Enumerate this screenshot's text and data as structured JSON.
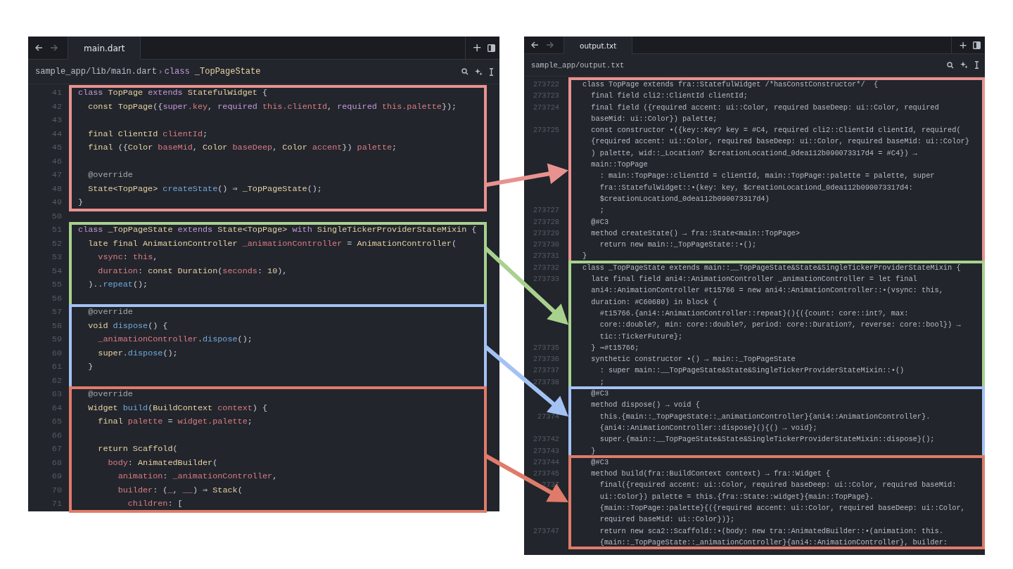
{
  "editors": [
    {
      "tab": {
        "label": "main.dart",
        "selected": true
      },
      "new_tab": "+",
      "breadcrumb": {
        "path": "sample_app/lib/main.dart",
        "separator": "›",
        "symbol": [
          {
            "text": "class ",
            "kind": "keyword"
          },
          {
            "text": "_TopPageState",
            "kind": "type"
          }
        ]
      },
      "sections": [
        {
          "color": "#e8928f",
          "lines": [
            {
              "n": "41",
              "tokens": [
                {
                  "text": "class ",
                  "kind": "keyword"
                },
                {
                  "text": "TopPage ",
                  "kind": "type"
                },
                {
                  "text": "extends ",
                  "kind": "keyword"
                },
                {
                  "text": "StatefulWidget ",
                  "kind": "type"
                },
                {
                  "text": "{",
                  "kind": "plain"
                }
              ]
            },
            {
              "n": "42",
              "tokens": [
                {
                  "text": "  const TopPage",
                  "kind": "type"
                },
                {
                  "text": "({",
                  "kind": "plain"
                },
                {
                  "text": "super",
                  "kind": "keyword"
                },
                {
                  "text": ".key",
                  "kind": "name"
                },
                {
                  "text": ", ",
                  "kind": "plain"
                },
                {
                  "text": "required ",
                  "kind": "keyword"
                },
                {
                  "text": "this.clientId",
                  "kind": "name"
                },
                {
                  "text": ", ",
                  "kind": "plain"
                },
                {
                  "text": "required ",
                  "kind": "keyword"
                },
                {
                  "text": "this.palette",
                  "kind": "name"
                },
                {
                  "text": "});",
                  "kind": "plain"
                }
              ]
            },
            {
              "n": "43"
            },
            {
              "n": "44",
              "tokens": [
                {
                  "text": "  final ClientId ",
                  "kind": "type"
                },
                {
                  "text": "clientId",
                  "kind": "name"
                },
                {
                  "text": ";",
                  "kind": "plain"
                }
              ]
            },
            {
              "n": "45",
              "tokens": [
                {
                  "text": "  final ",
                  "kind": "type"
                },
                {
                  "text": "({",
                  "kind": "plain"
                },
                {
                  "text": "Color ",
                  "kind": "type"
                },
                {
                  "text": "baseMid",
                  "kind": "name"
                },
                {
                  "text": ", ",
                  "kind": "plain"
                },
                {
                  "text": "Color ",
                  "kind": "type"
                },
                {
                  "text": "baseDeep",
                  "kind": "name"
                },
                {
                  "text": ", ",
                  "kind": "plain"
                },
                {
                  "text": "Color ",
                  "kind": "type"
                },
                {
                  "text": "accent",
                  "kind": "name"
                },
                {
                  "text": "}) ",
                  "kind": "plain"
                },
                {
                  "text": "palette",
                  "kind": "name"
                },
                {
                  "text": ";",
                  "kind": "plain"
                }
              ]
            },
            {
              "n": "46"
            },
            {
              "n": "47",
              "tokens": [
                {
                  "text": "  @override",
                  "kind": "annotation"
                }
              ]
            },
            {
              "n": "48",
              "tokens": [
                {
                  "text": "  State<TopPage> ",
                  "kind": "type"
                },
                {
                  "text": "createState",
                  "kind": "call"
                },
                {
                  "text": "() ⇒ ",
                  "kind": "plain"
                },
                {
                  "text": "_TopPageState",
                  "kind": "type"
                },
                {
                  "text": "();",
                  "kind": "plain"
                }
              ]
            },
            {
              "n": "49",
              "tokens": [
                {
                  "text": "}",
                  "kind": "plain"
                }
              ]
            }
          ]
        },
        {
          "lines": [
            {
              "n": "50"
            }
          ]
        },
        {
          "color": "#a9d18e",
          "lines": [
            {
              "n": "51",
              "tokens": [
                {
                  "text": "class ",
                  "kind": "keyword"
                },
                {
                  "text": "_TopPageState ",
                  "kind": "type"
                },
                {
                  "text": "extends ",
                  "kind": "keyword"
                },
                {
                  "text": "State<TopPage> ",
                  "kind": "type"
                },
                {
                  "text": "with ",
                  "kind": "keyword"
                },
                {
                  "text": "SingleTickerProviderStateMixin ",
                  "kind": "type"
                },
                {
                  "text": "{",
                  "kind": "plain"
                }
              ]
            },
            {
              "n": "52",
              "tokens": [
                {
                  "text": "  late final AnimationController ",
                  "kind": "type"
                },
                {
                  "text": "_animationController",
                  "kind": "name"
                },
                {
                  "text": " = ",
                  "kind": "plain"
                },
                {
                  "text": "AnimationController",
                  "kind": "type"
                },
                {
                  "text": "(",
                  "kind": "plain"
                }
              ]
            },
            {
              "n": "53",
              "tokens": [
                {
                  "text": "    vsync",
                  "kind": "name"
                },
                {
                  "text": ": ",
                  "kind": "plain"
                },
                {
                  "text": "this",
                  "kind": "name"
                },
                {
                  "text": ",",
                  "kind": "plain"
                }
              ]
            },
            {
              "n": "54",
              "tokens": [
                {
                  "text": "    duration",
                  "kind": "name"
                },
                {
                  "text": ": ",
                  "kind": "plain"
                },
                {
                  "text": "const Duration",
                  "kind": "type"
                },
                {
                  "text": "(",
                  "kind": "plain"
                },
                {
                  "text": "seconds",
                  "kind": "name"
                },
                {
                  "text": ": ",
                  "kind": "plain"
                },
                {
                  "text": "10",
                  "kind": "type"
                },
                {
                  "text": "),",
                  "kind": "plain"
                }
              ]
            },
            {
              "n": "55",
              "tokens": [
                {
                  "text": "  )..",
                  "kind": "plain"
                },
                {
                  "text": "repeat",
                  "kind": "call"
                },
                {
                  "text": "();",
                  "kind": "plain"
                }
              ]
            },
            {
              "n": "56"
            }
          ]
        },
        {
          "color": "#a4c2f4",
          "lines": [
            {
              "n": "57",
              "tokens": [
                {
                  "text": "  @override",
                  "kind": "annotation"
                }
              ]
            },
            {
              "n": "58",
              "tokens": [
                {
                  "text": "  void ",
                  "kind": "type"
                },
                {
                  "text": "dispose",
                  "kind": "call"
                },
                {
                  "text": "() {",
                  "kind": "plain"
                }
              ]
            },
            {
              "n": "59",
              "tokens": [
                {
                  "text": "    _animationController",
                  "kind": "name"
                },
                {
                  "text": ".",
                  "kind": "plain"
                },
                {
                  "text": "dispose",
                  "kind": "call"
                },
                {
                  "text": "();",
                  "kind": "plain"
                }
              ]
            },
            {
              "n": "60",
              "tokens": [
                {
                  "text": "    super",
                  "kind": "type"
                },
                {
                  "text": ".",
                  "kind": "plain"
                },
                {
                  "text": "dispose",
                  "kind": "call"
                },
                {
                  "text": "();",
                  "kind": "plain"
                }
              ]
            },
            {
              "n": "61",
              "tokens": [
                {
                  "text": "  }",
                  "kind": "plain"
                }
              ]
            },
            {
              "n": "62"
            }
          ]
        },
        {
          "color": "#e07b6a",
          "lines": [
            {
              "n": "63",
              "tokens": [
                {
                  "text": "  @override",
                  "kind": "annotation"
                }
              ]
            },
            {
              "n": "64",
              "tokens": [
                {
                  "text": "  Widget ",
                  "kind": "type"
                },
                {
                  "text": "build",
                  "kind": "call"
                },
                {
                  "text": "(",
                  "kind": "plain"
                },
                {
                  "text": "BuildContext ",
                  "kind": "type"
                },
                {
                  "text": "context",
                  "kind": "name"
                },
                {
                  "text": ") {",
                  "kind": "plain"
                }
              ]
            },
            {
              "n": "65",
              "tokens": [
                {
                  "text": "    final ",
                  "kind": "type"
                },
                {
                  "text": "palette",
                  "kind": "name"
                },
                {
                  "text": " = ",
                  "kind": "plain"
                },
                {
                  "text": "widget.palette",
                  "kind": "name"
                },
                {
                  "text": ";",
                  "kind": "plain"
                }
              ]
            },
            {
              "n": "66"
            },
            {
              "n": "67",
              "tokens": [
                {
                  "text": "    return Scaffold",
                  "kind": "type"
                },
                {
                  "text": "(",
                  "kind": "plain"
                }
              ]
            },
            {
              "n": "68",
              "tokens": [
                {
                  "text": "      body",
                  "kind": "name"
                },
                {
                  "text": ": ",
                  "kind": "plain"
                },
                {
                  "text": "AnimatedBuilder",
                  "kind": "type"
                },
                {
                  "text": "(",
                  "kind": "plain"
                }
              ]
            },
            {
              "n": "69",
              "tokens": [
                {
                  "text": "        animation",
                  "kind": "name"
                },
                {
                  "text": ": ",
                  "kind": "plain"
                },
                {
                  "text": "_animationController",
                  "kind": "name"
                },
                {
                  "text": ",",
                  "kind": "plain"
                }
              ]
            },
            {
              "n": "70",
              "tokens": [
                {
                  "text": "        builder",
                  "kind": "name"
                },
                {
                  "text": ": (",
                  "kind": "plain"
                },
                {
                  "text": "_",
                  "kind": "name"
                },
                {
                  "text": ", ",
                  "kind": "plain"
                },
                {
                  "text": "__",
                  "kind": "name"
                },
                {
                  "text": ") ⇒ ",
                  "kind": "plain"
                },
                {
                  "text": "Stack",
                  "kind": "type"
                },
                {
                  "text": "(",
                  "kind": "plain"
                }
              ]
            },
            {
              "n": "71",
              "tokens": [
                {
                  "text": "          children",
                  "kind": "name"
                },
                {
                  "text": ": ",
                  "kind": "plain"
                },
                {
                  "text": "[",
                  "kind": "plain"
                }
              ]
            }
          ]
        }
      ]
    },
    {
      "tab": {
        "label": "output.txt",
        "selected": true
      },
      "new_tab": "+",
      "breadcrumb": {
        "path": "sample_app/output.txt"
      },
      "sections": [
        {
          "color": "#e8928f",
          "lines": [
            {
              "n": "273722",
              "code": "class TopPage extends fra::StatefulWidget /*hasConstConstructor*/  {"
            },
            {
              "n": "273723",
              "code": "  final field cli2::ClientId clientId;"
            },
            {
              "n": "273724",
              "code": "  final field ({required accent: ui::Color, required baseDeep: ui::Color, required"
            },
            {
              "code": "  baseMid: ui::Color}) palette;"
            },
            {
              "n": "273725",
              "code": "  const constructor •({key::Key? key = #C4, required cli2::ClientId clientId, required("
            },
            {
              "code": "  {required accent: ui::Color, required baseDeep: ui::Color, required baseMid: ui::Color}"
            },
            {
              "code": "  ) palette, wid::_Location? $creationLocationd_0dea112b090073317d4 = #C4}) →"
            },
            {
              "code": "  main::TopPage"
            },
            {
              "code": "    : main::TopPage::clientId = clientId, main::TopPage::palette = palette, super"
            },
            {
              "code": "    fra::StatefulWidget::•(key: key, $creationLocationd_0dea112b090073317d4:"
            },
            {
              "code": "    $creationLocationd_0dea112b090073317d4)"
            },
            {
              "n": "273727",
              "code": "    ;"
            },
            {
              "n": "273728",
              "code": "  @#C3"
            },
            {
              "n": "273729",
              "code": "  method createState() → fra::State<main::TopPage>"
            },
            {
              "n": "273730",
              "code": "    return new main::_TopPageState::•();"
            },
            {
              "n": "273731",
              "code": "}"
            }
          ]
        },
        {
          "color": "#a9d18e",
          "lines": [
            {
              "n": "273732",
              "code": "class _TopPageState extends main::__TopPageState&State&SingleTickerProviderStateMixin {"
            },
            {
              "n": "273733",
              "code": "  late final field ani4::AnimationController _animationController = let final"
            },
            {
              "code": "  ani4::AnimationController #t15766 = new ani4::AnimationController::•(vsync: this,"
            },
            {
              "code": "  duration: #C60680) in block {"
            },
            {
              "code": "    #t15766.{ani4::AnimationController::repeat}(){({count: core::int?, max:"
            },
            {
              "code": "    core::double?, min: core::double?, period: core::Duration?, reverse: core::bool}) →"
            },
            {
              "code": "    tic::TickerFuture};"
            },
            {
              "n": "273735",
              "code": "  } ⇒#t15766;"
            },
            {
              "n": "273736",
              "code": "  synthetic constructor •() → main::_TopPageState"
            },
            {
              "n": "273737",
              "code": "    : super main::__TopPageState&State&SingleTickerProviderStateMixin::•()"
            },
            {
              "n": "273738",
              "code": "    ;"
            }
          ]
        },
        {
          "color": "#a4c2f4",
          "lines": [
            {
              "code": "  @#C3"
            },
            {
              "code": "  method dispose() → void {"
            },
            {
              "n": "27374",
              "code": "    this.{main::_TopPageState::_animationController}{ani4::AnimationController}."
            },
            {
              "code": "    {ani4::AnimationController::dispose}(){() → void};"
            },
            {
              "n": "273742",
              "code": "    super.{main::__TopPageState&State&SingleTickerProviderStateMixin::dispose}();"
            },
            {
              "n": "273743",
              "code": "  }"
            }
          ]
        },
        {
          "color": "#e07b6a",
          "lines": [
            {
              "n": "273744",
              "code": "  @#C3"
            },
            {
              "n": "273745",
              "code": "  method build(fra::BuildContext context) → fra::Widget {"
            },
            {
              "n": "2737",
              "code": "    final({required accent: ui::Color, required baseDeep: ui::Color, required baseMid:"
            },
            {
              "code": "    ui::Color}) palette = this.{fra::State::widget}{main::TopPage}."
            },
            {
              "code": "    {main::TopPage::palette}{({required accent: ui::Color, required baseDeep: ui::Color,"
            },
            {
              "code": "    required baseMid: ui::Color})};"
            },
            {
              "n": "273747",
              "code": "    return new sca2::Scaffold::•(body: new tra::AnimatedBuilder::•(animation: this."
            },
            {
              "code": "    {main::_TopPageState::_animationController}{ani4::AnimationController}, builder:"
            }
          ]
        }
      ]
    }
  ]
}
